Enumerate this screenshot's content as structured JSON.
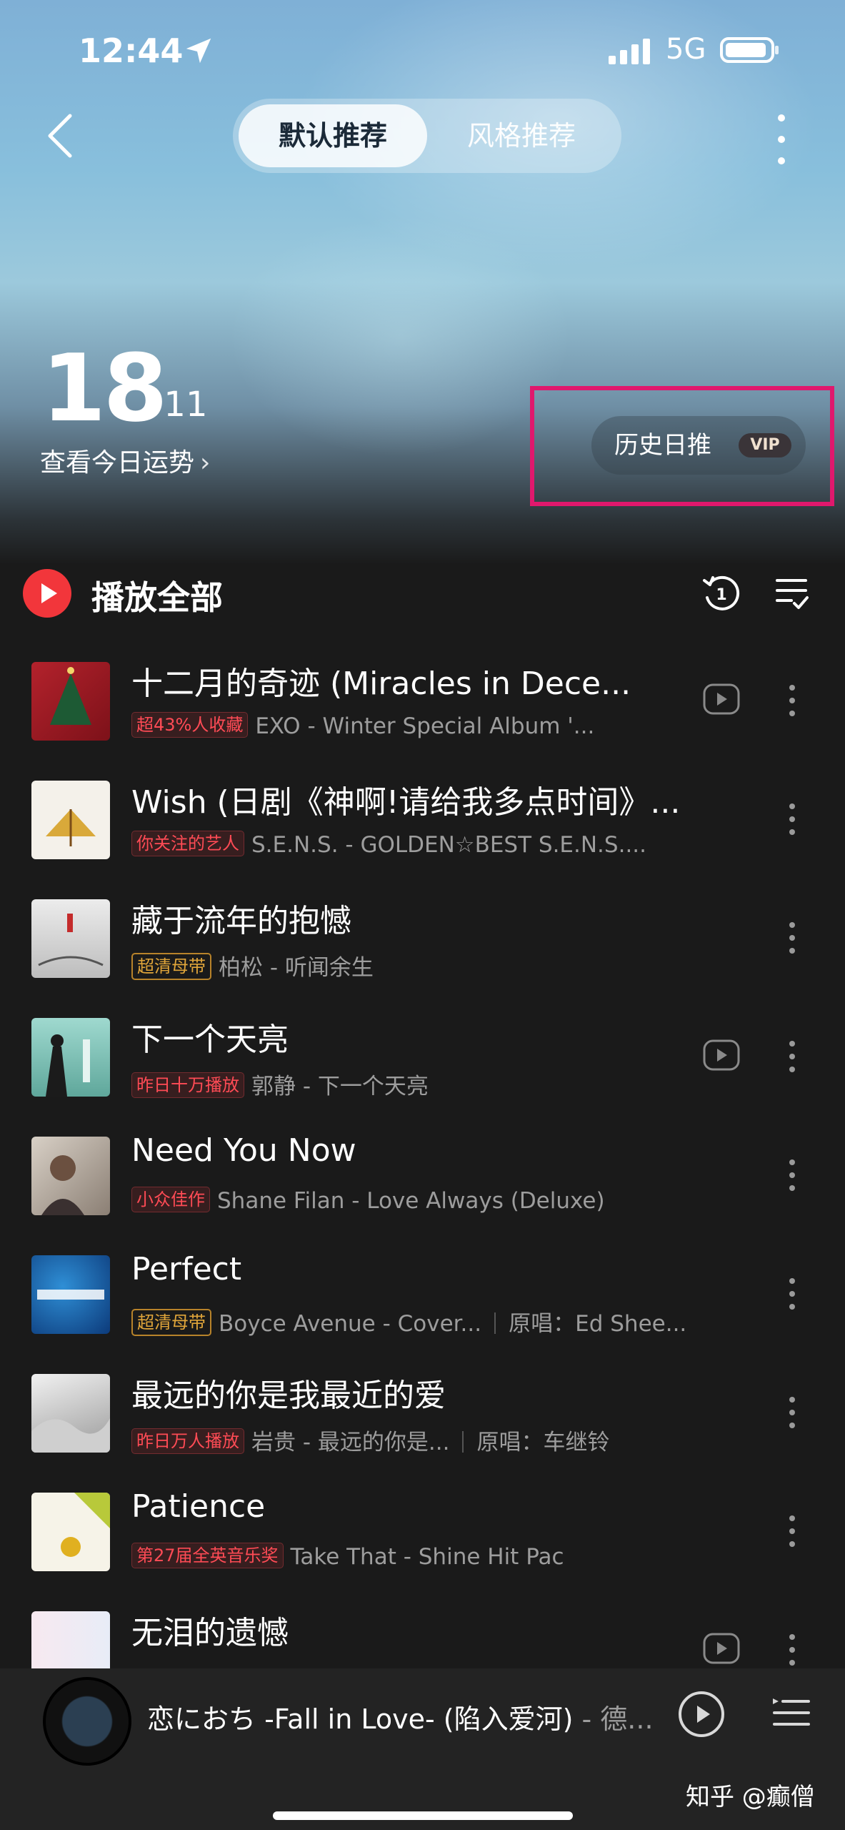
{
  "status_bar": {
    "time": "12:44",
    "network": "5G"
  },
  "header": {
    "tabs": [
      {
        "label": "默认推荐",
        "active": true
      },
      {
        "label": "风格推荐",
        "active": false
      }
    ]
  },
  "date": {
    "day": "18",
    "month": "/ 11",
    "fortune_link": "查看今日运势"
  },
  "history": {
    "label": "历史日推",
    "vip": "VIP"
  },
  "toolbar": {
    "play_all": "播放全部"
  },
  "songs": [
    {
      "title": "十二月的奇迹 (Miracles in Dece...",
      "badge": "超43%人收藏",
      "badge_style": "red",
      "meta": "EXO - Winter Special Album '...",
      "has_mv": true
    },
    {
      "title": "Wish (日剧《神啊!请给我多点时间》...",
      "badge": "你关注的艺人",
      "badge_style": "red",
      "meta": "S.E.N.S. - GOLDEN☆BEST S.E.N.S....",
      "has_mv": false
    },
    {
      "title": "藏于流年的抱憾",
      "badge": "超清母带",
      "badge_style": "gold",
      "meta": "柏松 - 听闻余生",
      "has_mv": false
    },
    {
      "title": "下一个天亮",
      "badge": "昨日十万播放",
      "badge_style": "red",
      "meta": "郭静 - 下一个天亮",
      "has_mv": true
    },
    {
      "title": "Need You Now",
      "badge": "小众佳作",
      "badge_style": "red",
      "meta": "Shane Filan - Love Always (Deluxe)",
      "has_mv": false
    },
    {
      "title": "Perfect",
      "badge": "超清母带",
      "badge_style": "gold",
      "meta": "Boyce Avenue - Cover...",
      "original": "原唱：Ed Shee...",
      "has_mv": false
    },
    {
      "title": "最远的你是我最近的爱",
      "badge": "昨日万人播放",
      "badge_style": "red",
      "meta": "岩贵 - 最远的你是...",
      "original": "原唱：车继铃",
      "has_mv": false
    },
    {
      "title": "Patience",
      "badge": "第27届全英音乐奖",
      "badge_style": "red",
      "meta": "Take That - Shine Hit Pac",
      "has_mv": false
    },
    {
      "title": "无泪的遗憾",
      "badge": "",
      "badge_style": "gold",
      "meta": "",
      "has_mv": true
    }
  ],
  "player": {
    "song": "恋におち -Fall in Love- (陷入爱河)",
    "artist": " - 德...",
    "watermark": "知乎 @癫僧"
  },
  "colors": {
    "accent_red": "#f2363b",
    "highlight_box": "#e0186d"
  }
}
